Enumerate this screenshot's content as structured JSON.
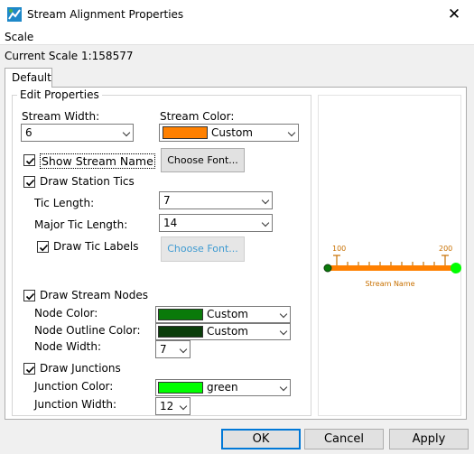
{
  "window": {
    "title": "Stream Alignment Properties"
  },
  "menu": {
    "scale": "Scale"
  },
  "scale_text": "Current Scale 1:158577",
  "tabs": [
    {
      "label": "Default"
    }
  ],
  "group": {
    "title": "Edit Properties"
  },
  "stream_width": {
    "label": "Stream Width:",
    "value": "6"
  },
  "stream_color": {
    "label": "Stream Color:",
    "value": "Custom",
    "swatch": "#ff8000"
  },
  "show_name": {
    "label": "Show Stream Name",
    "checked": true,
    "font_button": "Choose Font..."
  },
  "station_tics": {
    "label": "Draw Station Tics",
    "checked": true
  },
  "tic_length": {
    "label": "Tic Length:",
    "value": "7"
  },
  "major_tic_length": {
    "label": "Major Tic Length:",
    "value": "14"
  },
  "tic_labels": {
    "label": "Draw Tic Labels",
    "checked": true,
    "font_button": "Choose Font..."
  },
  "stream_nodes": {
    "label": "Draw Stream Nodes",
    "checked": true
  },
  "node_color": {
    "label": "Node Color:",
    "value": "Custom",
    "swatch": "#0a7a0a"
  },
  "node_outline_color": {
    "label": "Node Outline Color:",
    "value": "Custom",
    "swatch": "#0a3d0a"
  },
  "node_width": {
    "label": "Node Width:",
    "value": "7"
  },
  "junctions": {
    "label": "Draw Junctions",
    "checked": true
  },
  "junction_color": {
    "label": "Junction Color:",
    "value": "green",
    "swatch": "#00ff00"
  },
  "junction_width": {
    "label": "Junction Width:",
    "value": "12"
  },
  "preview": {
    "tick_start": "100",
    "tick_end": "200",
    "stream_name": "Stream Name",
    "line_color": "#ff8000",
    "label_color": "#c87000"
  },
  "buttons": {
    "ok": "OK",
    "cancel": "Cancel",
    "apply": "Apply"
  }
}
